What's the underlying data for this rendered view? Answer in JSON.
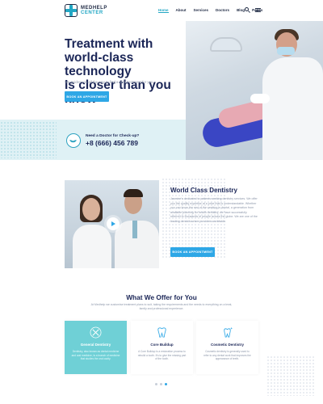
{
  "header": {
    "logo_line1": "MEDHELP",
    "logo_line2": "CENTER",
    "nav": [
      {
        "label": "Home"
      },
      {
        "label": "About"
      },
      {
        "label": "Services"
      },
      {
        "label": "Doctors"
      },
      {
        "label": "Blog"
      },
      {
        "label": "Pages"
      }
    ]
  },
  "hero": {
    "title_line1": "Treatment with",
    "title_line2": "world-class technology",
    "title_line3": "Is closer than you know",
    "subtitle": "We guides you all the way to find a best treatment for you",
    "button": "BOOK AN APPOINTMENT",
    "call_label": "Need a Doctor for Check-up?",
    "call_phone": "+8 (666) 456 789"
  },
  "dentistry": {
    "title": "World Class Dentistry",
    "body": "Jasmine’s dedicated to patients seeking dentistry services. We offer you the quality expertise at a price that is understandable. Whether you can know the rest of the seeking in dental, a generation from available planning for health dentistry, we have successfully referred to thousands of people across the globe. We are one of the leading dental tourism providers worldwide.",
    "button": "BOOK AN APPOINTMENT"
  },
  "offer": {
    "title": "What We Offer for You",
    "subtitle": "At Medhelp we customise treatment plans to suit, taking the requirements and the needs to everything on a treat, family and professional experience.",
    "cards": [
      {
        "icon": "tooth-tools-icon",
        "title": "General Dentistry",
        "desc": "Dentistry, also known as dental medicine and oral medicine, is a branch of medicine that studies the oral cavity."
      },
      {
        "icon": "tooth-icon",
        "title": "Core Buildup",
        "desc": "A Core Buildup is a restoration process to rebuild a tooth. It's to give the missing part of the tooth."
      },
      {
        "icon": "tooth-shine-icon",
        "title": "Cosmetic Dentistry",
        "desc": "Cosmetic dentistry is generally used to refer to any dental work that improves the appearance of teeth."
      }
    ]
  },
  "colors": {
    "accent": "#2ea7e6",
    "teal": "#6fd0d6",
    "navy": "#1b2657",
    "band": "#dff1f5"
  }
}
